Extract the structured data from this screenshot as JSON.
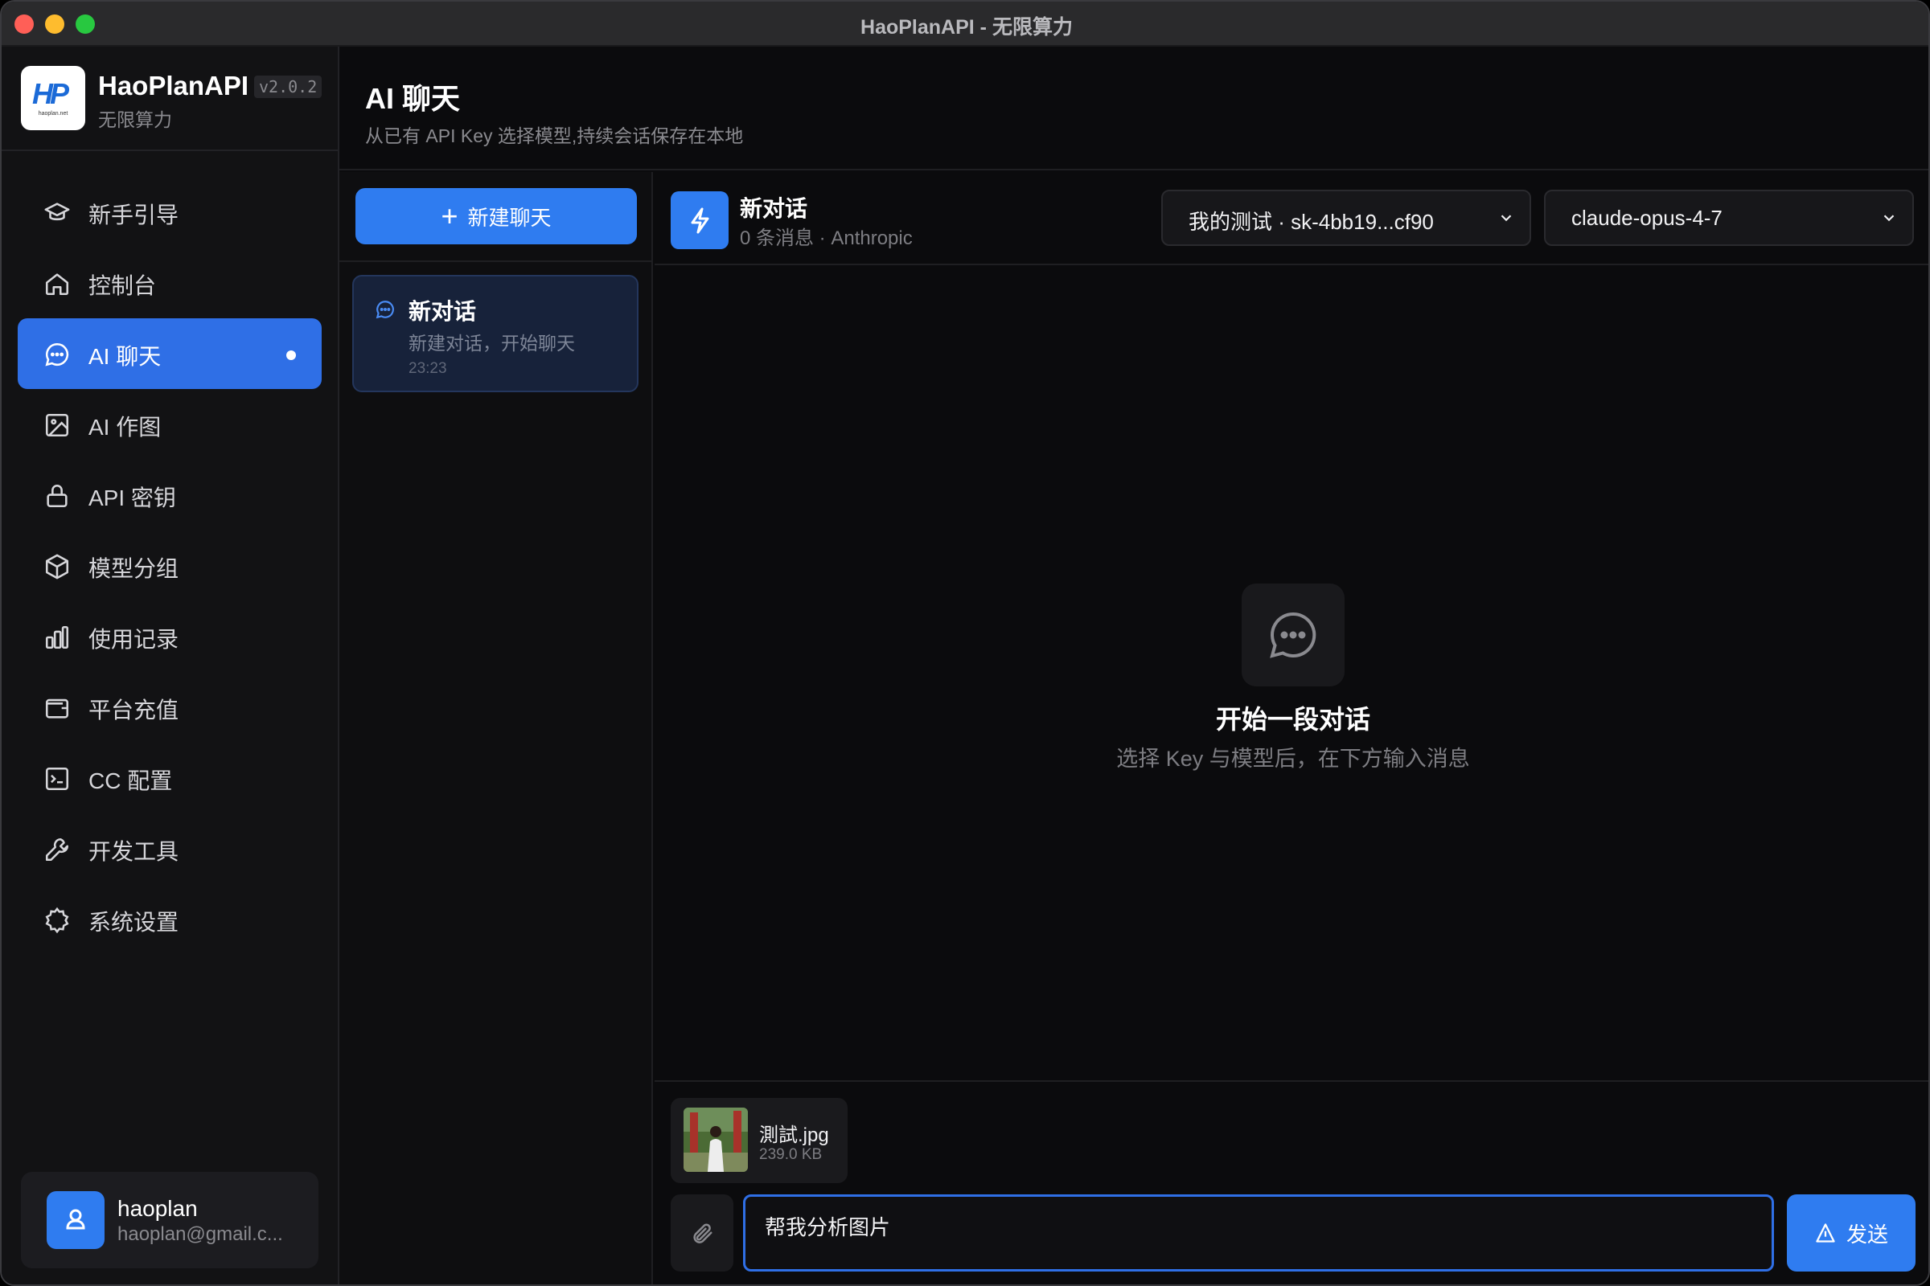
{
  "window": {
    "title": "HaoPlanAPI - 无限算力"
  },
  "brand": {
    "logo_text": "HP",
    "logo_sub": "haoplan.net",
    "name": "HaoPlanAPI",
    "version": "v2.0.2",
    "tagline": "无限算力"
  },
  "nav": {
    "items": [
      {
        "label": "新手引导",
        "icon": "graduation-cap-icon",
        "active": false
      },
      {
        "label": "控制台",
        "icon": "home-icon",
        "active": false
      },
      {
        "label": "AI 聊天",
        "icon": "chat-bubble-icon",
        "active": true
      },
      {
        "label": "AI 作图",
        "icon": "image-icon",
        "active": false
      },
      {
        "label": "API 密钥",
        "icon": "lock-icon",
        "active": false
      },
      {
        "label": "模型分组",
        "icon": "cube-icon",
        "active": false
      },
      {
        "label": "使用记录",
        "icon": "bar-chart-icon",
        "active": false
      },
      {
        "label": "平台充值",
        "icon": "wallet-icon",
        "active": false
      },
      {
        "label": "CC 配置",
        "icon": "terminal-icon",
        "active": false
      },
      {
        "label": "开发工具",
        "icon": "wrench-icon",
        "active": false
      },
      {
        "label": "系统设置",
        "icon": "gear-icon",
        "active": false
      }
    ]
  },
  "user": {
    "name": "haoplan",
    "email": "haoplan@gmail.c..."
  },
  "header": {
    "title": "AI 聊天",
    "subtitle": "从已有 API Key 选择模型,持续会话保存在本地"
  },
  "conversations": {
    "new_button": "新建聊天",
    "items": [
      {
        "title": "新对话",
        "preview": "新建对话，开始聊天",
        "time": "23:23"
      }
    ]
  },
  "chat": {
    "title": "新对话",
    "meta": "0 条消息 · Anthropic",
    "key_select": "我的测试 · sk-4bb19...cf90",
    "model_select": "claude-opus-4-7",
    "empty_title": "开始一段对话",
    "empty_subtitle": "选择 Key 与模型后，在下方输入消息",
    "attachment": {
      "name": "測試.jpg",
      "size": "239.0 KB"
    },
    "input_value": "帮我分析图片",
    "send_label": "发送"
  },
  "colors": {
    "accent": "#2f7cf0",
    "sidebar_bg": "#121214",
    "window_bg": "#0b0b0d"
  }
}
